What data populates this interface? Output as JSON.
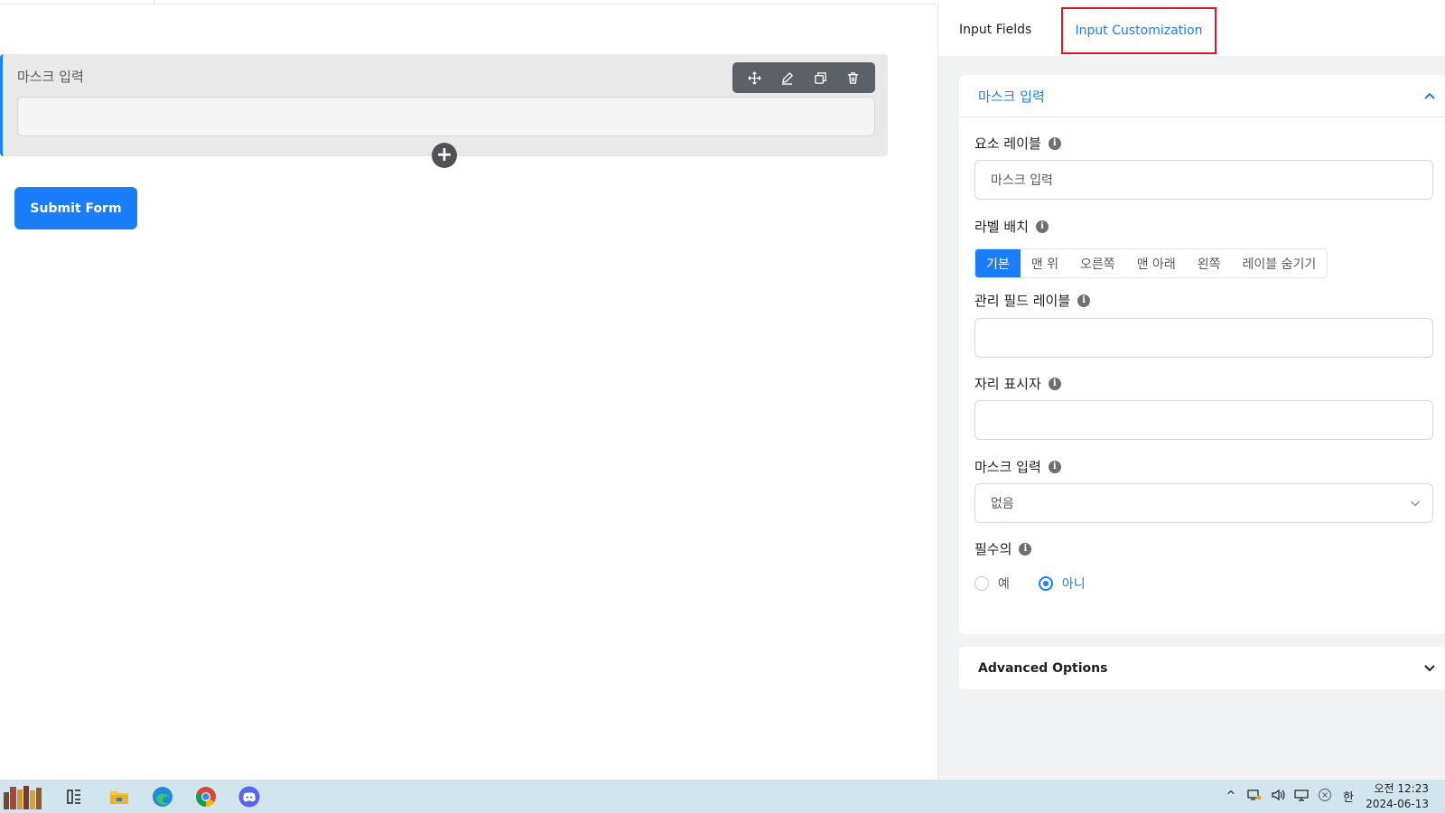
{
  "editor": {
    "field_label": "마스크 입력",
    "submit_label": "Submit Form",
    "add_symbol": "+"
  },
  "panel": {
    "tabs": [
      {
        "label": "Input Fields",
        "active": false
      },
      {
        "label": "Input Customization",
        "active": true
      }
    ],
    "section_title": "마스크 입력",
    "element_label": {
      "label": "요소 레이블",
      "value": "마스크 입력"
    },
    "label_placement": {
      "label": "라벨 배치",
      "options": [
        "기본",
        "맨 위",
        "오른쪽",
        "맨 아래",
        "왼쪽",
        "레이블 숨기기"
      ],
      "selected": "기본"
    },
    "admin_label": {
      "label": "관리 필드 레이블",
      "value": ""
    },
    "placeholder": {
      "label": "자리 표시자",
      "value": ""
    },
    "mask_input": {
      "label": "마스크 입력",
      "value": "없음"
    },
    "required": {
      "label": "필수의",
      "options": [
        "예",
        "아니"
      ],
      "selected": "아니"
    },
    "advanced_options": "Advanced Options",
    "info_symbol": "i"
  },
  "taskbar": {
    "clock_period_time": "오전 12:23",
    "date": "2024-06-13",
    "ime": "한",
    "tray_up": "^"
  },
  "colors": {
    "accent": "#1a7efb",
    "highlight_box": "#e0141e",
    "taskbar": "#d2e4ee"
  },
  "icons": [
    "move-icon",
    "edit-icon",
    "duplicate-icon",
    "delete-icon",
    "plus-icon",
    "chevron-up-icon",
    "chevron-down-icon",
    "info-icon",
    "edge-icon",
    "chrome-icon",
    "discord-icon",
    "file-explorer-icon",
    "task-view-icon"
  ]
}
